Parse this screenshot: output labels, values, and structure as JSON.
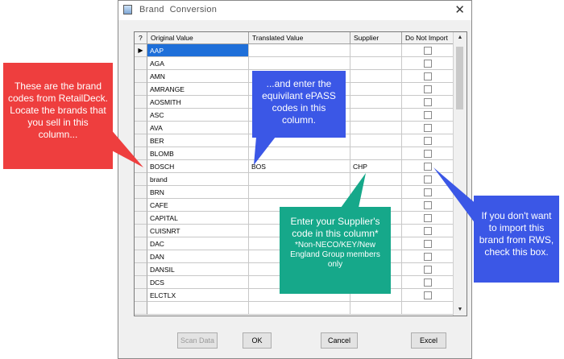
{
  "window": {
    "title": "Brand  Conversion"
  },
  "grid": {
    "columns": [
      "?",
      "Original Value",
      "Translated  Value",
      "Supplier",
      "Do Not Import"
    ],
    "rows": [
      {
        "original": "AAP",
        "translated": "",
        "supplier": "",
        "marker": "▶"
      },
      {
        "original": "AGA",
        "translated": "",
        "supplier": "",
        "marker": ""
      },
      {
        "original": "AMN",
        "translated": "",
        "supplier": "",
        "marker": ""
      },
      {
        "original": "AMRANGE",
        "translated": "",
        "supplier": "",
        "marker": ""
      },
      {
        "original": "AOSMITH",
        "translated": "",
        "supplier": "",
        "marker": ""
      },
      {
        "original": "ASC",
        "translated": "",
        "supplier": "",
        "marker": ""
      },
      {
        "original": "AVA",
        "translated": "",
        "supplier": "",
        "marker": ""
      },
      {
        "original": "BER",
        "translated": "",
        "supplier": "",
        "marker": ""
      },
      {
        "original": "BLOMB",
        "translated": "",
        "supplier": "",
        "marker": ""
      },
      {
        "original": "BOSCH",
        "translated": "BOS",
        "supplier": "CHP",
        "marker": ""
      },
      {
        "original": "brand",
        "translated": "",
        "supplier": "",
        "marker": ""
      },
      {
        "original": "BRN",
        "translated": "",
        "supplier": "",
        "marker": ""
      },
      {
        "original": "CAFE",
        "translated": "",
        "supplier": "",
        "marker": ""
      },
      {
        "original": "CAPITAL",
        "translated": "",
        "supplier": "",
        "marker": ""
      },
      {
        "original": "CUISNRT",
        "translated": "",
        "supplier": "",
        "marker": ""
      },
      {
        "original": "DAC",
        "translated": "",
        "supplier": "",
        "marker": ""
      },
      {
        "original": "DAN",
        "translated": "",
        "supplier": "",
        "marker": ""
      },
      {
        "original": "DANSIL",
        "translated": "",
        "supplier": "",
        "marker": ""
      },
      {
        "original": "DCS",
        "translated": "",
        "supplier": "",
        "marker": ""
      },
      {
        "original": "ELCTLX",
        "translated": "",
        "supplier": "",
        "marker": ""
      },
      {
        "original": "",
        "translated": "",
        "supplier": "",
        "marker": ""
      }
    ]
  },
  "buttons": {
    "scan": "Scan Data",
    "ok": "OK",
    "cancel": "Cancel",
    "excel": "Excel"
  },
  "callouts": {
    "red": "These are the brand codes from RetailDeck. Locate the brands that you sell in this column...",
    "blue_center": "...and enter the equivilant ePASS codes in this column.",
    "green_main": "Enter your Supplier's code in this column*",
    "green_note": "*Non-NECO/KEY/New England Group members only",
    "blue_right": "If you don't want to import this brand from RWS, check this box."
  },
  "colors": {
    "red": "#ee3e3e",
    "blue": "#3b57e6",
    "green": "#16a88a",
    "selection": "#1e6fd9"
  }
}
